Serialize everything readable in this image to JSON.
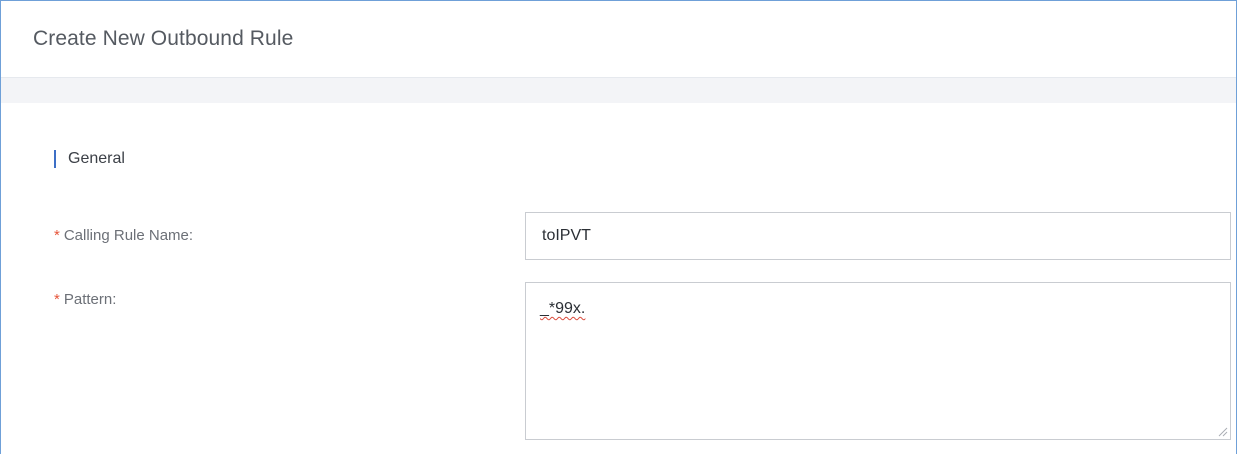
{
  "dialog": {
    "title": "Create New Outbound Rule"
  },
  "section": {
    "title": "General"
  },
  "fields": {
    "calling_rule_name": {
      "required_mark": "*",
      "label": "Calling Rule Name:",
      "value": "toIPVT"
    },
    "pattern": {
      "required_mark": "*",
      "label": "Pattern:",
      "value": "_*99x."
    }
  },
  "colors": {
    "accent": "#3d6fc6",
    "required": "#e6553a",
    "frame_border": "#6fa0d8"
  }
}
